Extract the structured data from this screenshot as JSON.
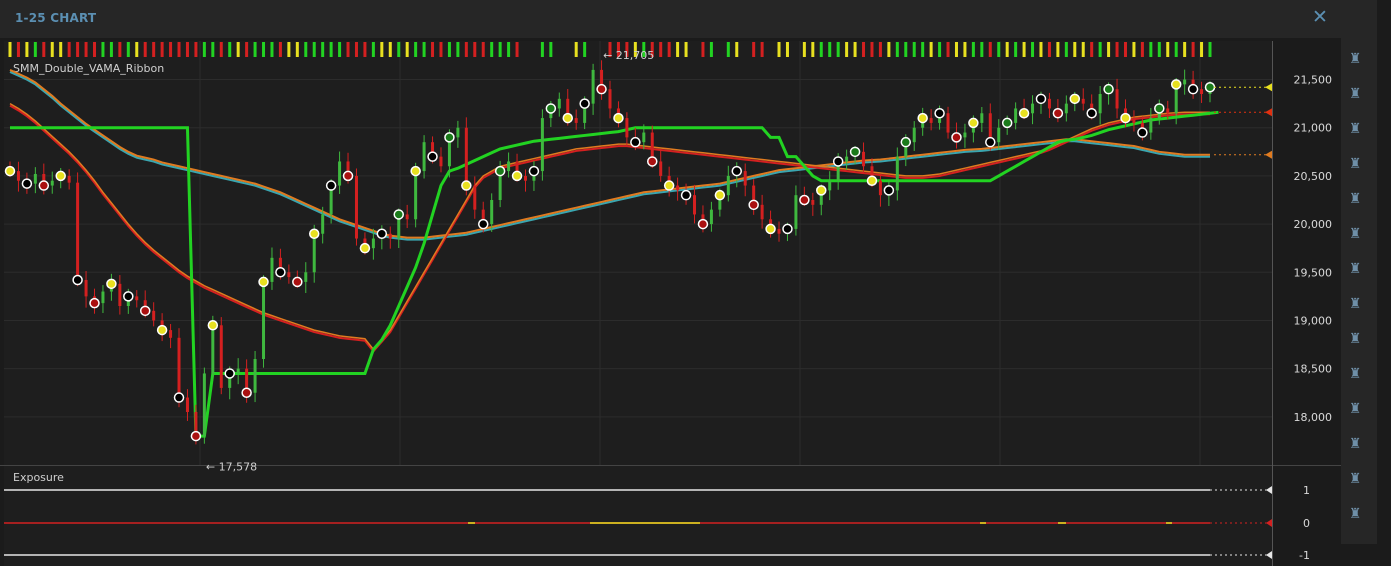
{
  "window": {
    "title": "1-25 CHART",
    "close_icon": "close-icon"
  },
  "toolbar_icons": [
    "robot-icon",
    "robot-icon",
    "robot-icon",
    "robot-icon",
    "robot-icon",
    "robot-icon",
    "robot-icon",
    "robot-icon",
    "robot-icon",
    "robot-icon",
    "robot-icon",
    "robot-icon",
    "robot-icon",
    "robot-icon"
  ],
  "colors": {
    "bg": "#1b1b1b",
    "grid": "#2c2c2c",
    "up": "#3fb83f",
    "down": "#d42020",
    "green_line": "#22d322",
    "orange": "#e07b20",
    "teal": "#3aa6b0",
    "red": "#e03010",
    "yellow": "#e8e020"
  },
  "chart_data": [
    {
      "type": "candlestick",
      "title": "SMM_Double_VAMA_Ribbon",
      "ylim": [
        17500,
        21900
      ],
      "yticks": [
        "21,500",
        "21,000",
        "20,500",
        "20,000",
        "19,500",
        "19,000",
        "18,500",
        "18,000"
      ],
      "ytick_values": [
        21500,
        21000,
        20500,
        20000,
        19500,
        19000,
        18500,
        18000
      ],
      "annotations": [
        {
          "label": "21,705",
          "value": 21705
        },
        {
          "label": "17,578",
          "value": 17578
        }
      ],
      "last_price_markers": [
        {
          "value": 21420,
          "color": "#e8e020"
        },
        {
          "value": 21160,
          "color": "#e03010"
        },
        {
          "value": 20720,
          "color": "#e07b20"
        }
      ],
      "closes": [
        20550,
        20450,
        20420,
        20520,
        20400,
        20450,
        20500,
        20430,
        19420,
        19250,
        19180,
        19300,
        19380,
        19150,
        19250,
        19210,
        19100,
        19000,
        18900,
        18820,
        18200,
        18050,
        17800,
        18450,
        18950,
        18300,
        18450,
        18500,
        18250,
        18600,
        19400,
        19650,
        19500,
        19450,
        19400,
        19500,
        19900,
        20100,
        20400,
        20650,
        20500,
        19850,
        19750,
        19850,
        19900,
        19850,
        20100,
        20050,
        20550,
        20850,
        20700,
        20600,
        20900,
        21000,
        20400,
        20150,
        20000,
        20250,
        20550,
        20650,
        20500,
        20450,
        20550,
        21100,
        21200,
        21300,
        21100,
        21050,
        21250,
        21600,
        21400,
        21200,
        21100,
        20900,
        20850,
        20950,
        20650,
        20500,
        20400,
        20350,
        20300,
        20100,
        20000,
        20150,
        20300,
        20500,
        20550,
        20400,
        20200,
        20050,
        19950,
        19900,
        19950,
        20300,
        20250,
        20200,
        20350,
        20450,
        20650,
        20700,
        20750,
        20600,
        20450,
        20300,
        20350,
        20700,
        20850,
        21000,
        21100,
        21050,
        21150,
        20950,
        20900,
        20950,
        21050,
        21150,
        20850,
        21000,
        21050,
        21200,
        21150,
        21250,
        21300,
        21200,
        21150,
        21250,
        21300,
        21250,
        21150,
        21350,
        21400,
        21200,
        21100,
        21050,
        20950,
        21100,
        21200,
        21150,
        21450,
        21500,
        21400,
        21350,
        21420
      ],
      "ema_fast": [
        21600,
        21560,
        21520,
        21470,
        21400,
        21330,
        21250,
        21180,
        21110,
        21040,
        20980,
        20920,
        20860,
        20800,
        20750,
        20710,
        20690,
        20670,
        20640,
        20620,
        20600,
        20580,
        20560,
        20540,
        20520,
        20500,
        20480,
        20460,
        20440,
        20420,
        20390,
        20360,
        20330,
        20290,
        20250,
        20210,
        20170,
        20130,
        20090,
        20050,
        20020,
        19990,
        19960,
        19930,
        19900,
        19880,
        19870,
        19860,
        19860,
        19860,
        19870,
        19880,
        19890,
        19900,
        19910,
        19930,
        19950,
        19970,
        19990,
        20010,
        20030,
        20050,
        20070,
        20090,
        20110,
        20130,
        20150,
        20170,
        20190,
        20210,
        20230,
        20250,
        20270,
        20290,
        20310,
        20330,
        20340,
        20350,
        20360,
        20370,
        20380,
        20390,
        20400,
        20410,
        20420,
        20440,
        20460,
        20480,
        20500,
        20520,
        20540,
        20560,
        20570,
        20580,
        20590,
        20600,
        20610,
        20620,
        20630,
        20640,
        20650,
        20660,
        20665,
        20670,
        20680,
        20690,
        20700,
        20710,
        20720,
        20730,
        20740,
        20750,
        20760,
        20770,
        20775,
        20780,
        20790,
        20800,
        20810,
        20820,
        20830,
        20840,
        20850,
        20860,
        20870,
        20880,
        20880,
        20870,
        20860,
        20850,
        20840,
        20830,
        20820,
        20810,
        20790,
        20770,
        20750,
        20740,
        20730,
        20720,
        20720,
        20720,
        20720
      ],
      "ema_slow": [
        21250,
        21200,
        21140,
        21070,
        20990,
        20910,
        20830,
        20750,
        20660,
        20560,
        20450,
        20330,
        20220,
        20110,
        20000,
        19900,
        19810,
        19730,
        19660,
        19590,
        19520,
        19460,
        19410,
        19360,
        19320,
        19280,
        19240,
        19200,
        19160,
        19120,
        19080,
        19050,
        19020,
        18990,
        18960,
        18930,
        18900,
        18880,
        18860,
        18840,
        18830,
        18820,
        18810,
        18700,
        18800,
        18900,
        19050,
        19200,
        19350,
        19500,
        19650,
        19800,
        19950,
        20100,
        20250,
        20400,
        20500,
        20550,
        20600,
        20620,
        20640,
        20660,
        20680,
        20700,
        20720,
        20740,
        20760,
        20780,
        20790,
        20800,
        20810,
        20820,
        20830,
        20830,
        20820,
        20810,
        20800,
        20790,
        20780,
        20770,
        20760,
        20750,
        20740,
        20730,
        20720,
        20710,
        20700,
        20690,
        20680,
        20670,
        20660,
        20650,
        20640,
        20630,
        20620,
        20610,
        20600,
        20590,
        20580,
        20570,
        20560,
        20550,
        20540,
        20530,
        20520,
        20510,
        20500,
        20500,
        20500,
        20510,
        20520,
        20540,
        20560,
        20580,
        20600,
        20620,
        20640,
        20660,
        20680,
        20700,
        20720,
        20740,
        20760,
        20790,
        20830,
        20870,
        20910,
        20950,
        20990,
        21020,
        21050,
        21070,
        21090,
        21110,
        21120,
        21130,
        21140,
        21150,
        21155,
        21160,
        21160,
        21160,
        21160
      ],
      "green_trail": [
        21000,
        21000,
        21000,
        21000,
        21000,
        21000,
        21000,
        21000,
        21000,
        21000,
        21000,
        21000,
        21000,
        21000,
        21000,
        21000,
        21000,
        21000,
        21000,
        21000,
        21000,
        21000,
        17800,
        17800,
        18450,
        18450,
        18450,
        18450,
        18450,
        18450,
        18450,
        18450,
        18450,
        18450,
        18450,
        18450,
        18450,
        18450,
        18450,
        18450,
        18450,
        18450,
        18450,
        18700,
        18800,
        18950,
        19150,
        19350,
        19550,
        19800,
        20100,
        20400,
        20550,
        20580,
        20620,
        20660,
        20700,
        20740,
        20780,
        20800,
        20820,
        20840,
        20860,
        20870,
        20880,
        20890,
        20900,
        20910,
        20920,
        20930,
        20940,
        20950,
        20960,
        20980,
        21000,
        21000,
        21000,
        21000,
        21000,
        21000,
        21000,
        21000,
        21000,
        21000,
        21000,
        21000,
        21000,
        21000,
        21000,
        21000,
        20900,
        20900,
        20700,
        20700,
        20600,
        20500,
        20450,
        20450,
        20450,
        20450,
        20450,
        20450,
        20450,
        20450,
        20450,
        20450,
        20450,
        20450,
        20450,
        20450,
        20450,
        20450,
        20450,
        20450,
        20450,
        20450,
        20450,
        20500,
        20550,
        20600,
        20650,
        20700,
        20750,
        20800,
        20850,
        20870,
        20880,
        20900,
        20920,
        20950,
        20980,
        21000,
        21020,
        21040,
        21060,
        21080,
        21090,
        21100,
        21110,
        21120,
        21130,
        21140,
        21150,
        21160
      ]
    },
    {
      "type": "line",
      "title": "Exposure",
      "ylim": [
        -1,
        1
      ],
      "yticks": [
        "1",
        "0",
        "-1"
      ],
      "ytick_values": [
        1,
        0,
        -1
      ]
    }
  ]
}
